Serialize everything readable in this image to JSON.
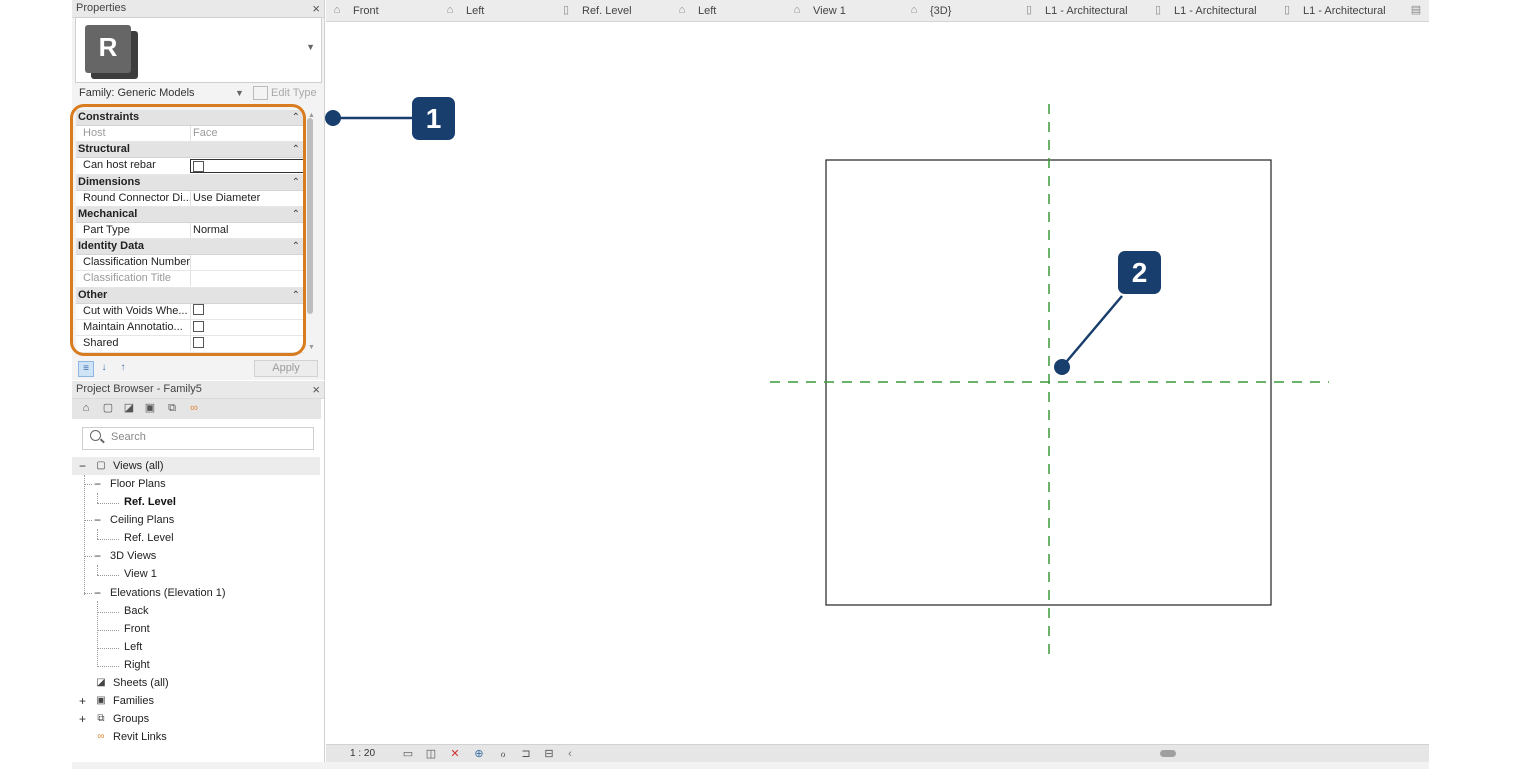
{
  "properties": {
    "title": "Properties",
    "close_icon": "×",
    "type_thumbnail_letter": "R",
    "family_label": "Family: Generic Models",
    "edit_type_label": "Edit Type",
    "apply_label": "Apply",
    "sections": [
      {
        "label": "Constraints",
        "rows": [
          {
            "name": "Host",
            "value": "Face",
            "disabled": true
          }
        ]
      },
      {
        "label": "Structural",
        "rows": [
          {
            "name": "Can host rebar",
            "checkbox": true
          }
        ]
      },
      {
        "label": "Dimensions",
        "rows": [
          {
            "name": "Round Connector Di...",
            "value": "Use Diameter"
          }
        ]
      },
      {
        "label": "Mechanical",
        "rows": [
          {
            "name": "Part Type",
            "value": "Normal"
          }
        ]
      },
      {
        "label": "Identity Data",
        "rows": [
          {
            "name": "Classification Number",
            "value": ""
          },
          {
            "name": "Classification Title",
            "value": "",
            "disabled": true
          }
        ]
      },
      {
        "label": "Other",
        "rows": [
          {
            "name": "Cut with Voids Whe...",
            "checkbox": true
          },
          {
            "name": "Maintain Annotatio...",
            "checkbox": true
          },
          {
            "name": "Shared",
            "checkbox": true
          }
        ]
      }
    ],
    "outline_color": "#d97c20"
  },
  "browser": {
    "title": "Project Browser - Family5",
    "close_icon": "×",
    "search_placeholder": "Search",
    "tree": {
      "views_all": "Views (all)",
      "floor_plans": "Floor Plans",
      "floor_ref_level": "Ref. Level",
      "ceiling_plans": "Ceiling Plans",
      "ceiling_ref_level": "Ref. Level",
      "views_3d": "3D Views",
      "view_1": "View 1",
      "elevations": "Elevations (Elevation 1)",
      "back": "Back",
      "front": "Front",
      "left": "Left",
      "right": "Right",
      "sheets": "Sheets (all)",
      "families": "Families",
      "groups": "Groups",
      "revit_links": "Revit Links"
    }
  },
  "tabs": [
    {
      "label": "Front",
      "icon": "elevation-icon"
    },
    {
      "label": "Left",
      "icon": "elevation-icon"
    },
    {
      "label": "Ref. Level",
      "icon": "plan-icon"
    },
    {
      "label": "Left",
      "icon": "elevation-icon"
    },
    {
      "label": "View 1",
      "icon": "3d-view-icon"
    },
    {
      "label": "{3D}",
      "icon": "3d-view-icon"
    },
    {
      "label": "L1 - Architectural",
      "icon": "plan-icon"
    },
    {
      "label": "L1 - Architectural",
      "icon": "plan-icon"
    },
    {
      "label": "L1 - Architectural",
      "icon": "plan-icon"
    }
  ],
  "status": {
    "scale": "1 : 20"
  },
  "callouts": {
    "one": "1",
    "two": "2",
    "color": "#183e6d"
  },
  "canvas": {
    "reference_plane_color": "#3a9a3a"
  }
}
